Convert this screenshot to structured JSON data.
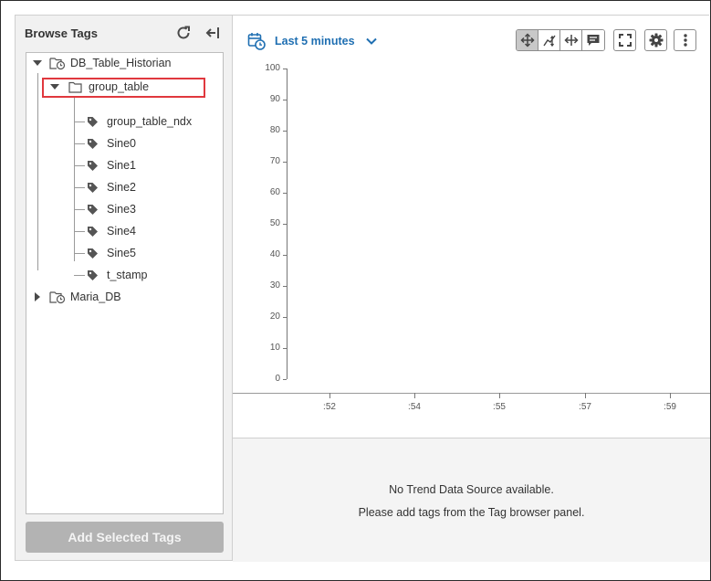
{
  "browse": {
    "title": "Browse Tags",
    "add_button_label": "Add Selected Tags",
    "tree": {
      "root": {
        "label": "DB_Table_Historian",
        "expanded": true
      },
      "group": {
        "label": "group_table",
        "expanded": true
      },
      "tags": [
        "group_table_ndx",
        "Sine0",
        "Sine1",
        "Sine2",
        "Sine3",
        "Sine4",
        "Sine5",
        "t_stamp"
      ],
      "second_root": {
        "label": "Maria_DB",
        "expanded": false
      }
    }
  },
  "trend": {
    "time_range_label": "Last 5 minutes",
    "y_ticks": [
      "100",
      "90",
      "80",
      "70",
      "60",
      "50",
      "40",
      "30",
      "20",
      "10",
      "0"
    ],
    "x_ticks": [
      ":52",
      ":54",
      ":55",
      ":57",
      ":59"
    ],
    "messages": {
      "line1": "No Trend Data Source available.",
      "line2": "Please add tags from the Tag browser panel."
    }
  },
  "colors": {
    "accent": "#1f6fb2",
    "highlight": "#e0383e",
    "disabled_button": "#b3b3b3"
  }
}
